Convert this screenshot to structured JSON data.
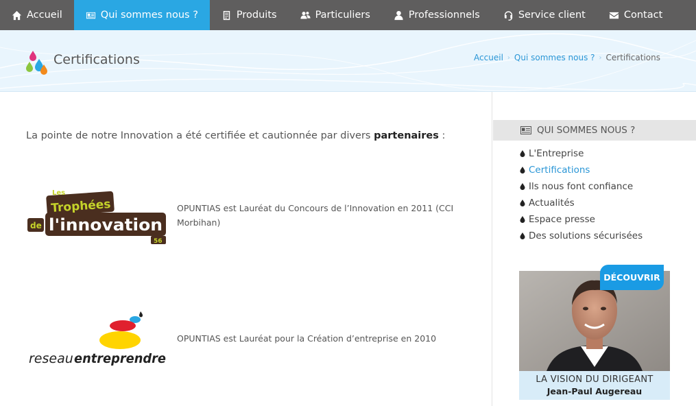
{
  "nav": {
    "items": [
      {
        "label": "Accueil",
        "icon": "home-icon"
      },
      {
        "label": "Qui sommes nous ?",
        "icon": "id-card-icon",
        "active": true
      },
      {
        "label": "Produits",
        "icon": "document-icon"
      },
      {
        "label": "Particuliers",
        "icon": "users-icon"
      },
      {
        "label": "Professionnels",
        "icon": "user-icon"
      },
      {
        "label": "Service client",
        "icon": "headset-icon"
      },
      {
        "label": "Contact",
        "icon": "envelope-icon"
      }
    ],
    "active_color": "#2aa7e3",
    "bg_color": "#5f5e5e"
  },
  "banner": {
    "title": "Certifications",
    "breadcrumb": [
      "Accueil",
      "Qui sommes nous ?",
      "Certifications"
    ]
  },
  "main": {
    "intro_text": "La pointe de notre Innovation a été certifiée et cautionnée par divers",
    "intro_bold": "partenaires",
    "intro_end": " :",
    "certs": [
      {
        "logo_lines": [
          "Les",
          "Trophées",
          "de",
          "l'innovation",
          "56"
        ],
        "text": "OPUNTIAS est Lauréat du Concours de l’Innovation en 2011 (CCI Morbihan)"
      },
      {
        "logo_text_light": "reseau",
        "logo_text_bold": "entreprendre",
        "text": "OPUNTIAS est Lauréat pour la Création d’entreprise en 2010"
      }
    ]
  },
  "sidebar": {
    "heading": "QUI SOMMES NOUS ?",
    "items": [
      {
        "label": "L'Entreprise"
      },
      {
        "label": "Certifications",
        "current": true
      },
      {
        "label": "Ils nous font confiance"
      },
      {
        "label": "Actualités"
      },
      {
        "label": "Espace presse"
      },
      {
        "label": "Des solutions sécurisées"
      }
    ],
    "card": {
      "badge": "DÉCOUVRIR",
      "caption_1": "LA VISION DU DIRIGEANT",
      "caption_2": "Jean-Paul Augereau"
    }
  }
}
